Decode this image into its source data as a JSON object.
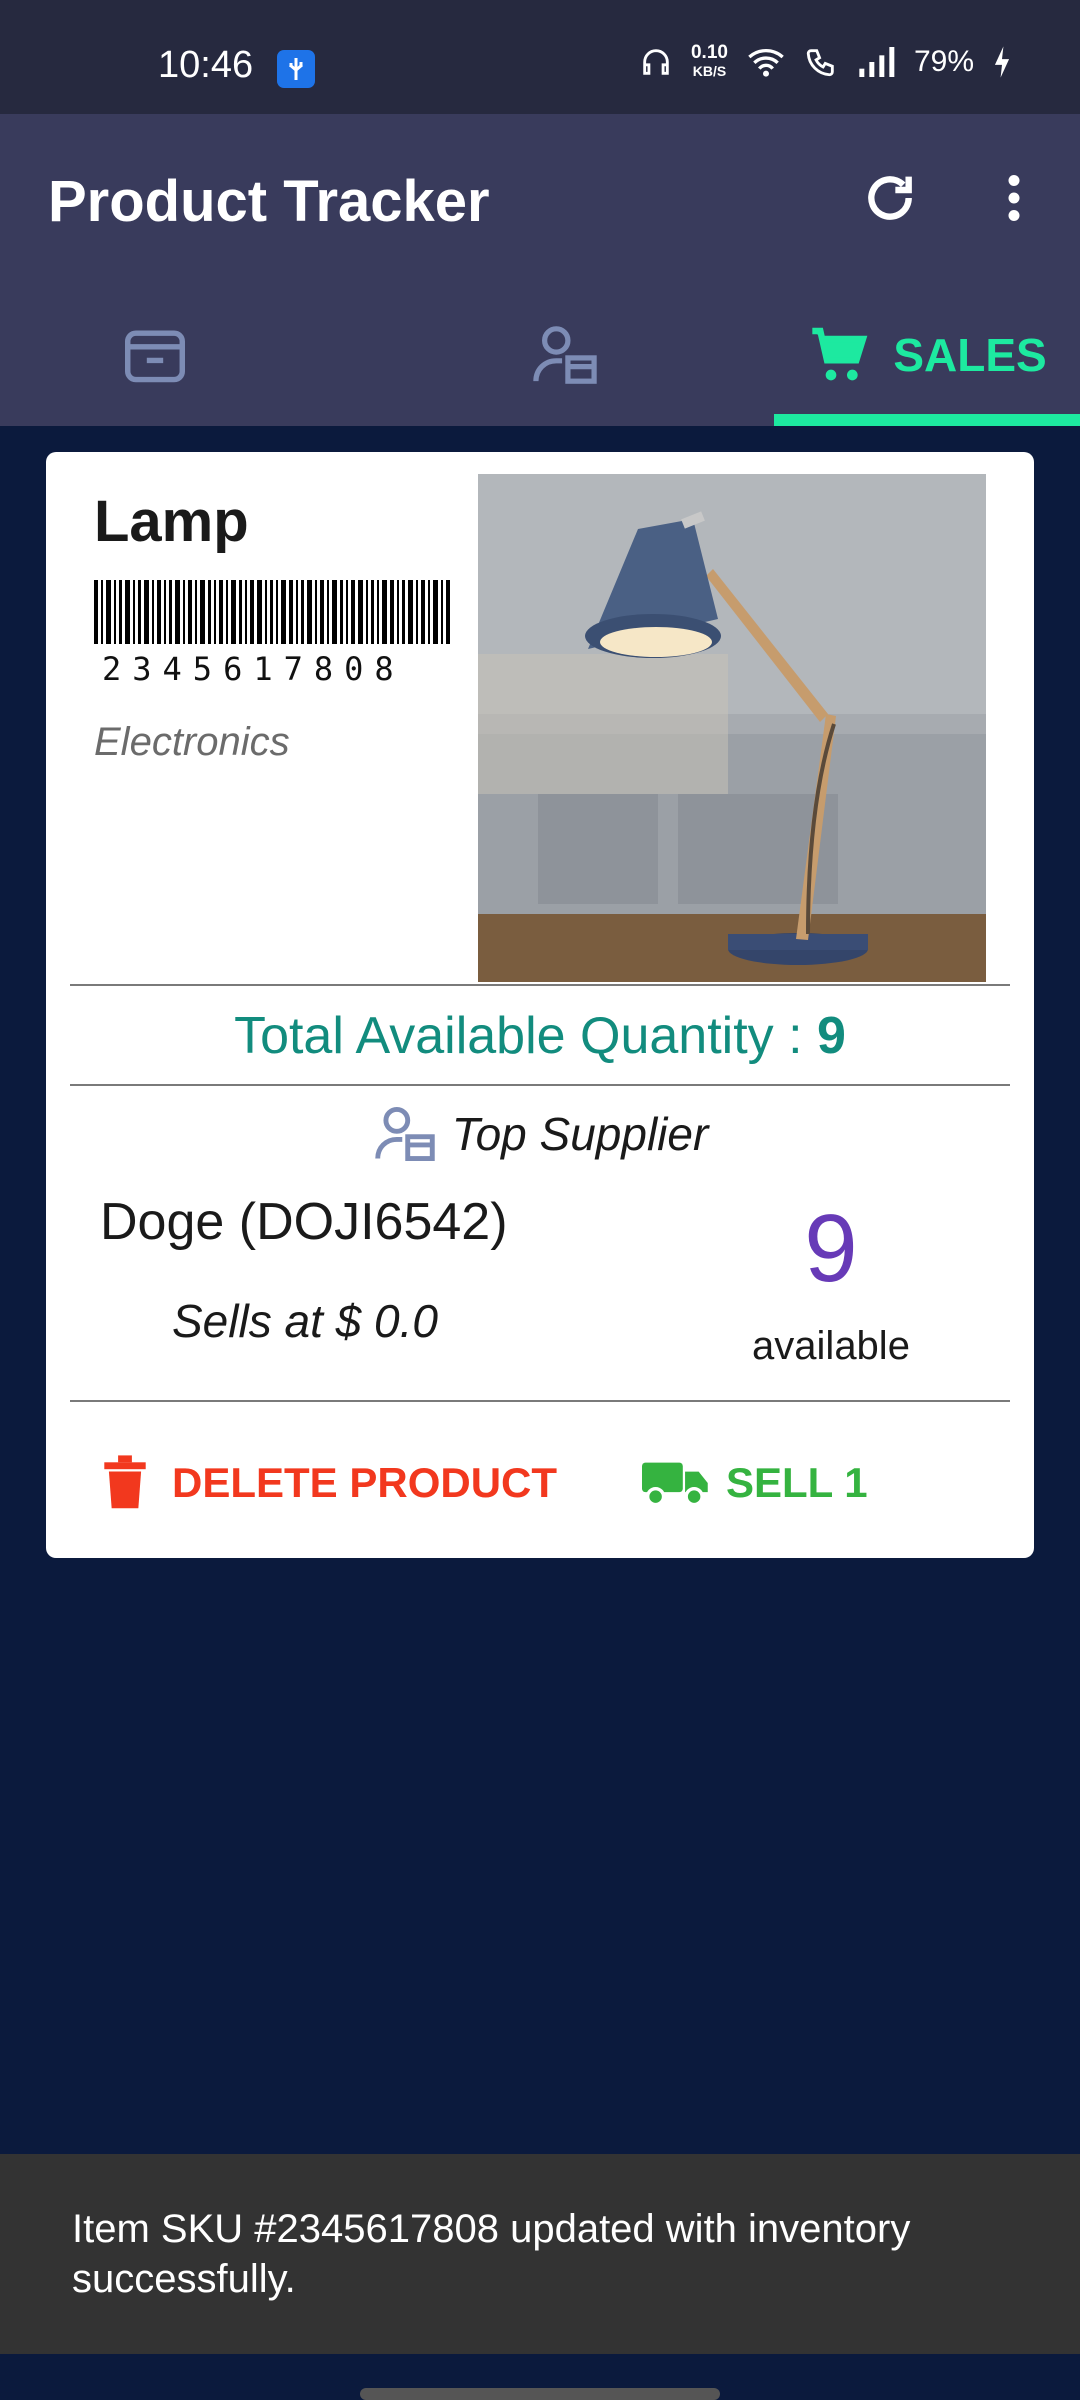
{
  "status_bar": {
    "time": "10:46",
    "net_speed_value": "0.10",
    "net_speed_unit": "KB/S",
    "battery": "79%"
  },
  "app_bar": {
    "title": "Product Tracker",
    "icons": [
      "refresh-icon",
      "more-vert-icon"
    ]
  },
  "tabs": [
    {
      "icon": "inventory-box-icon",
      "label": "",
      "selected": false
    },
    {
      "icon": "supplier-person-icon",
      "label": "",
      "selected": false
    },
    {
      "icon": "shopping-cart-icon",
      "label": "SALES",
      "selected": true
    }
  ],
  "product": {
    "name": "Lamp",
    "barcode": "2345617808",
    "category": "Electronics",
    "image": "desk-lamp-photo",
    "quantity_label": "Total Available Quantity : ",
    "quantity_value": "9",
    "top_supplier_label": "Top Supplier",
    "supplier_name": "Doge (DOJI6542)",
    "sells_at": "Sells at $ 0.0",
    "available_count": "9",
    "available_label": "available",
    "delete_label": "DELETE PRODUCT",
    "sell_label": "SELL 1"
  },
  "snackbar": {
    "message": "Item SKU #2345617808 updated with inventory successfully."
  },
  "colors": {
    "background": "#0b1a3d",
    "app_bar": "#393b5c",
    "accent": "#1de9a0",
    "quantity_text": "#128c7e",
    "available_count": "#673ab7",
    "delete": "#f2381e",
    "sell": "#35b340"
  }
}
